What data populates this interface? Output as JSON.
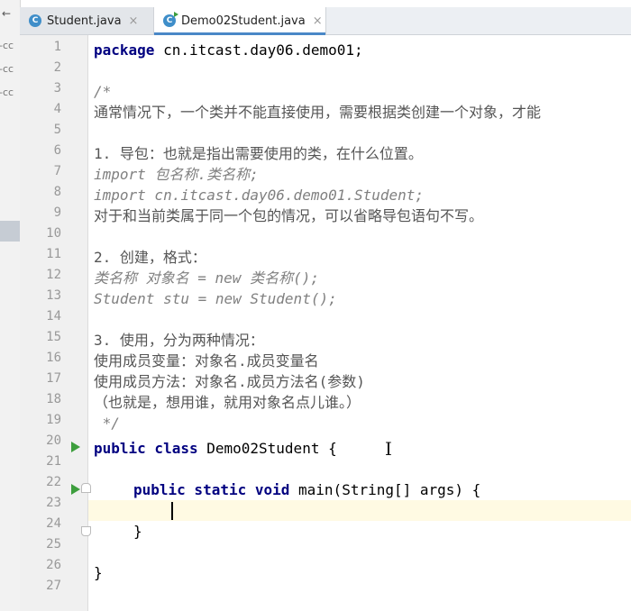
{
  "tabs": [
    {
      "label": "Student.java",
      "close": "×",
      "icon": "java-class-icon"
    },
    {
      "label": "Demo02Student.java",
      "close": "×",
      "icon": "java-class-run-icon",
      "active": true
    }
  ],
  "left_strip": {
    "back_arrow": "←",
    "fragments": [
      "-cc",
      "-cc",
      "-cc"
    ]
  },
  "editor": {
    "line_numbers": [
      "1",
      "2",
      "3",
      "4",
      "5",
      "6",
      "7",
      "8",
      "9",
      "10",
      "11",
      "12",
      "13",
      "14",
      "15",
      "16",
      "17",
      "18",
      "19",
      "20",
      "21",
      "22",
      "23",
      "24",
      "25",
      "26",
      "27"
    ],
    "lines": {
      "l1_kw": "package",
      "l1_rest": " cn.itcast.day06.demo01;",
      "l3": "/*",
      "l4": "通常情况下，一个类并不能直接使用，需要根据类创建一个对象，才能",
      "l6": "1. 导包：也就是指出需要使用的类，在什么位置。",
      "l7": "import 包名称.类名称;",
      "l8": "import cn.itcast.day06.demo01.Student;",
      "l9": "对于和当前类属于同一个包的情况，可以省略导包语句不写。",
      "l11": "2. 创建，格式：",
      "l12": "类名称 对象名 = new 类名称();",
      "l13": "Student stu = new Student();",
      "l15": "3. 使用，分为两种情况：",
      "l16": "使用成员变量：对象名.成员变量名",
      "l17": "使用成员方法：对象名.成员方法名(参数)",
      "l18": "（也就是，想用谁，就用对象名点儿谁。）",
      "l19": " */",
      "l20_kw": "public class",
      "l20_rest": " Demo02Student {",
      "l22_kw": "public static void",
      "l22_rest": " main(String[] args) {",
      "l24": "}",
      "l26": "}"
    }
  },
  "colors": {
    "keyword": "#000080",
    "comment": "#808080",
    "current_line": "#fffae3",
    "run_icon": "#3d9e3d"
  }
}
